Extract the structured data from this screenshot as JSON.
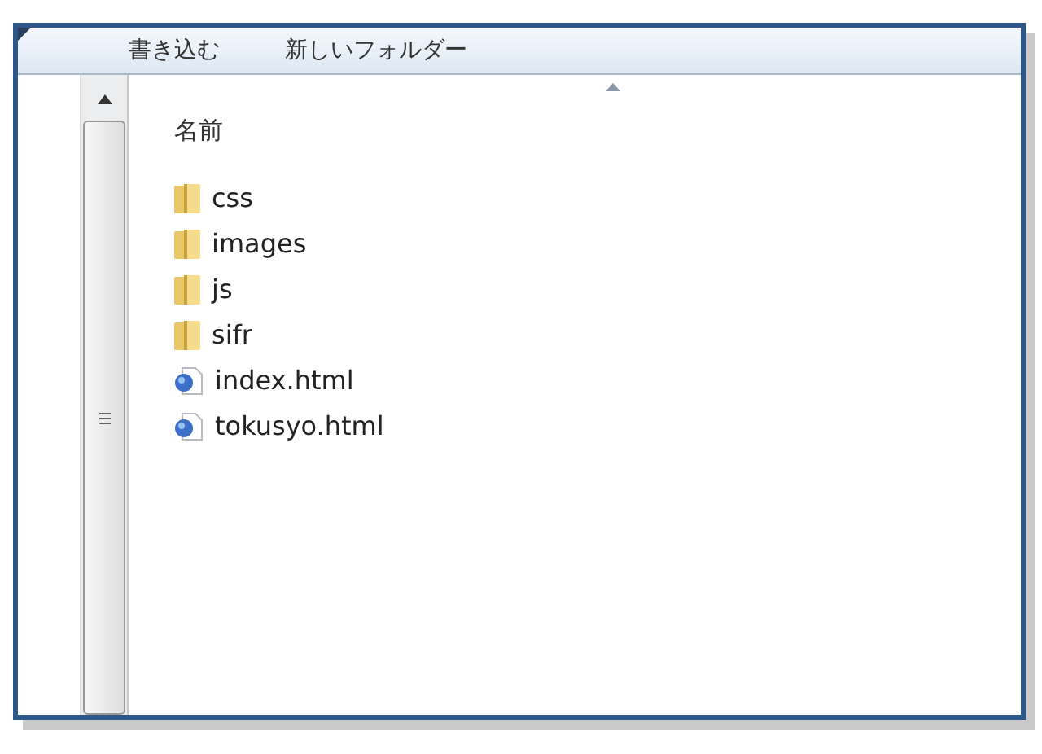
{
  "toolbar": {
    "buttons": [
      "書き込む",
      "新しいフォルダー"
    ]
  },
  "file_list": {
    "columns": [
      {
        "label": "名前",
        "sorted": true
      }
    ],
    "items": [
      {
        "name": "css",
        "kind": "folder"
      },
      {
        "name": "images",
        "kind": "folder"
      },
      {
        "name": "js",
        "kind": "folder"
      },
      {
        "name": "sifr",
        "kind": "folder"
      },
      {
        "name": "index.html",
        "kind": "html"
      },
      {
        "name": "tokusyo.html",
        "kind": "html"
      }
    ]
  }
}
